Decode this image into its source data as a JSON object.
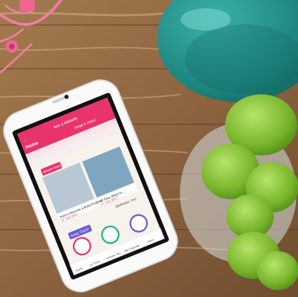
{
  "photo": {
    "subject": "smartphone-on-wooden-table",
    "colors": {
      "wood_light": "#b58a5c",
      "wood_dark": "#6b4a2c",
      "teal_bottle": "#1f8f8a",
      "plant_green": "#7dbb2a",
      "cable_pink": "#f07fa3",
      "phone_white": "#f4f4f4",
      "app_pink": "#e8336b"
    }
  },
  "app": {
    "status_right": "...",
    "header_right": "Ask a Midwife",
    "header_title": "Home",
    "header_link": "Read it Here!",
    "whats_new": "What's New",
    "card1_title": "How to Become a Body-Positive",
    "card1_date": "17 July 2017",
    "card2_title": "10 Easy Ways to...",
    "card2_date": "17 July 2017",
    "author": "@killiadas, Yes!",
    "keep_track": "Keep Track!",
    "nav_items": [
      "Home",
      "Le Clinic",
      "Articles Yes",
      "Me Calendar",
      "More"
    ]
  }
}
